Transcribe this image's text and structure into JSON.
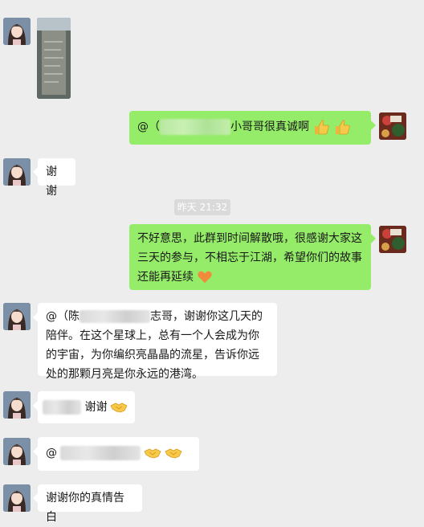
{
  "messages": {
    "m1": {
      "photo_label": "photo-message"
    },
    "m2": {
      "prefix": "@（",
      "suffix": "小哥哥很真诚啊"
    },
    "m3": {
      "text": "谢谢"
    },
    "timestamp": "昨天 21:32",
    "m4": {
      "text": "不好意思，此群到时间解散哦，很感谢大家这三天的参与，不相忘于江湖，希望你们的故事还能再延续"
    },
    "m5": {
      "prefix": "@（陈",
      "line1_suffix": "志哥，谢谢你这几天的陪",
      "rest": "伴。在这个星球上，总有一个人会成为你的宇宙，为你编织亮晶晶的流星，告诉你远处的那颗月亮是你永远的港湾。"
    },
    "m6": {
      "text": "谢谢"
    },
    "m7": {
      "prefix": "@"
    },
    "m8": {
      "text": "谢谢你的真情告白"
    }
  },
  "colors": {
    "received_bubble": "#ffffff",
    "sent_bubble": "#95ec69",
    "background": "#ededed"
  },
  "icons": [
    "thumbs-up-icon",
    "heart-icon",
    "handshake-icon"
  ]
}
